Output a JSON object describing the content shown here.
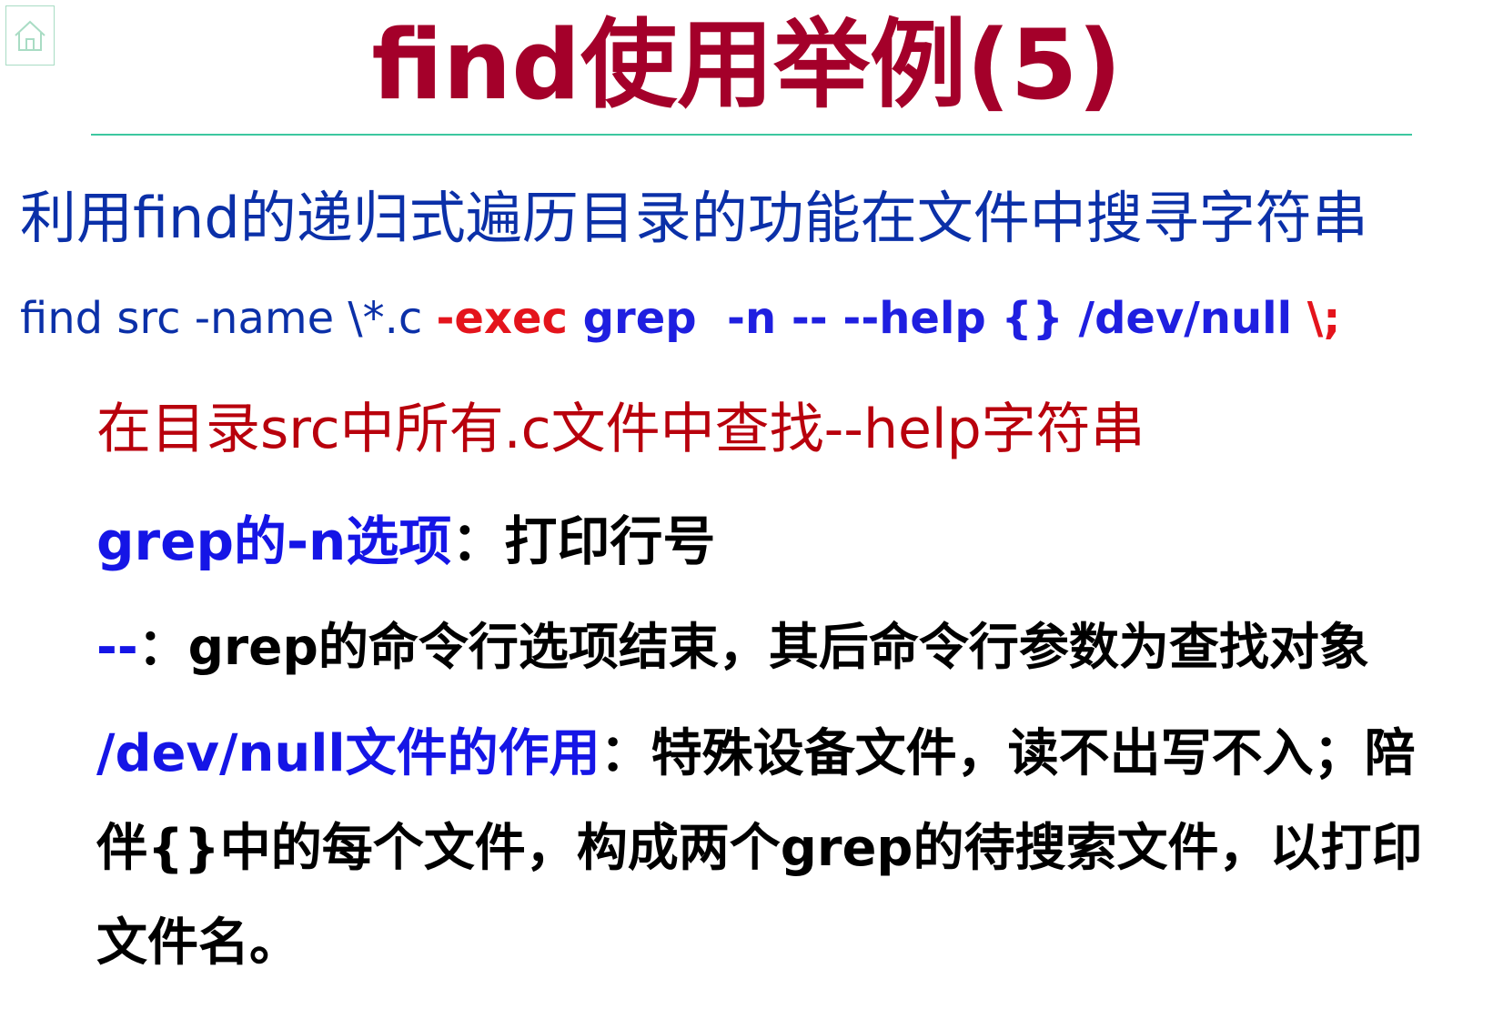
{
  "nav": {
    "home_icon": "home-icon",
    "accent_color": "#a9dcc4"
  },
  "title": "find使用举例(5)",
  "intro": "利用find的递归式遍历目录的功能在文件中搜寻字符串",
  "command": {
    "plain": "find src -name \\*.c ",
    "exec": "-exec",
    "grep": " grep  -n -- --help {} /dev/null ",
    "terminator": "\\;"
  },
  "description": "在目录src中所有.c文件中查找--help字符串",
  "grep_option": {
    "keyword": "grep的-n选项",
    "text": "：打印行号"
  },
  "double_dash": {
    "keyword": "--",
    "colon": "：",
    "grep": "grep",
    "text": "的命令行选项结束，其后命令行参数为查找对象"
  },
  "dev_null": {
    "keyword": "/dev/null文件的作用",
    "line1_text": "：特殊设备文件，读不出写不入；陪",
    "line2_a": "伴",
    "line2_braces": "{}",
    "line2_b": "中的每个文件，构成两个",
    "line2_grep": "grep",
    "line2_c": "的待搜索文件，以打印",
    "line3": "文件名。"
  },
  "colors": {
    "title": "#a4002a",
    "rule": "#3cc7a0",
    "intro": "#0b30a8",
    "exec_red": "#e4141c",
    "keyword_blue": "#1515e6",
    "description_red": "#b8000c"
  }
}
